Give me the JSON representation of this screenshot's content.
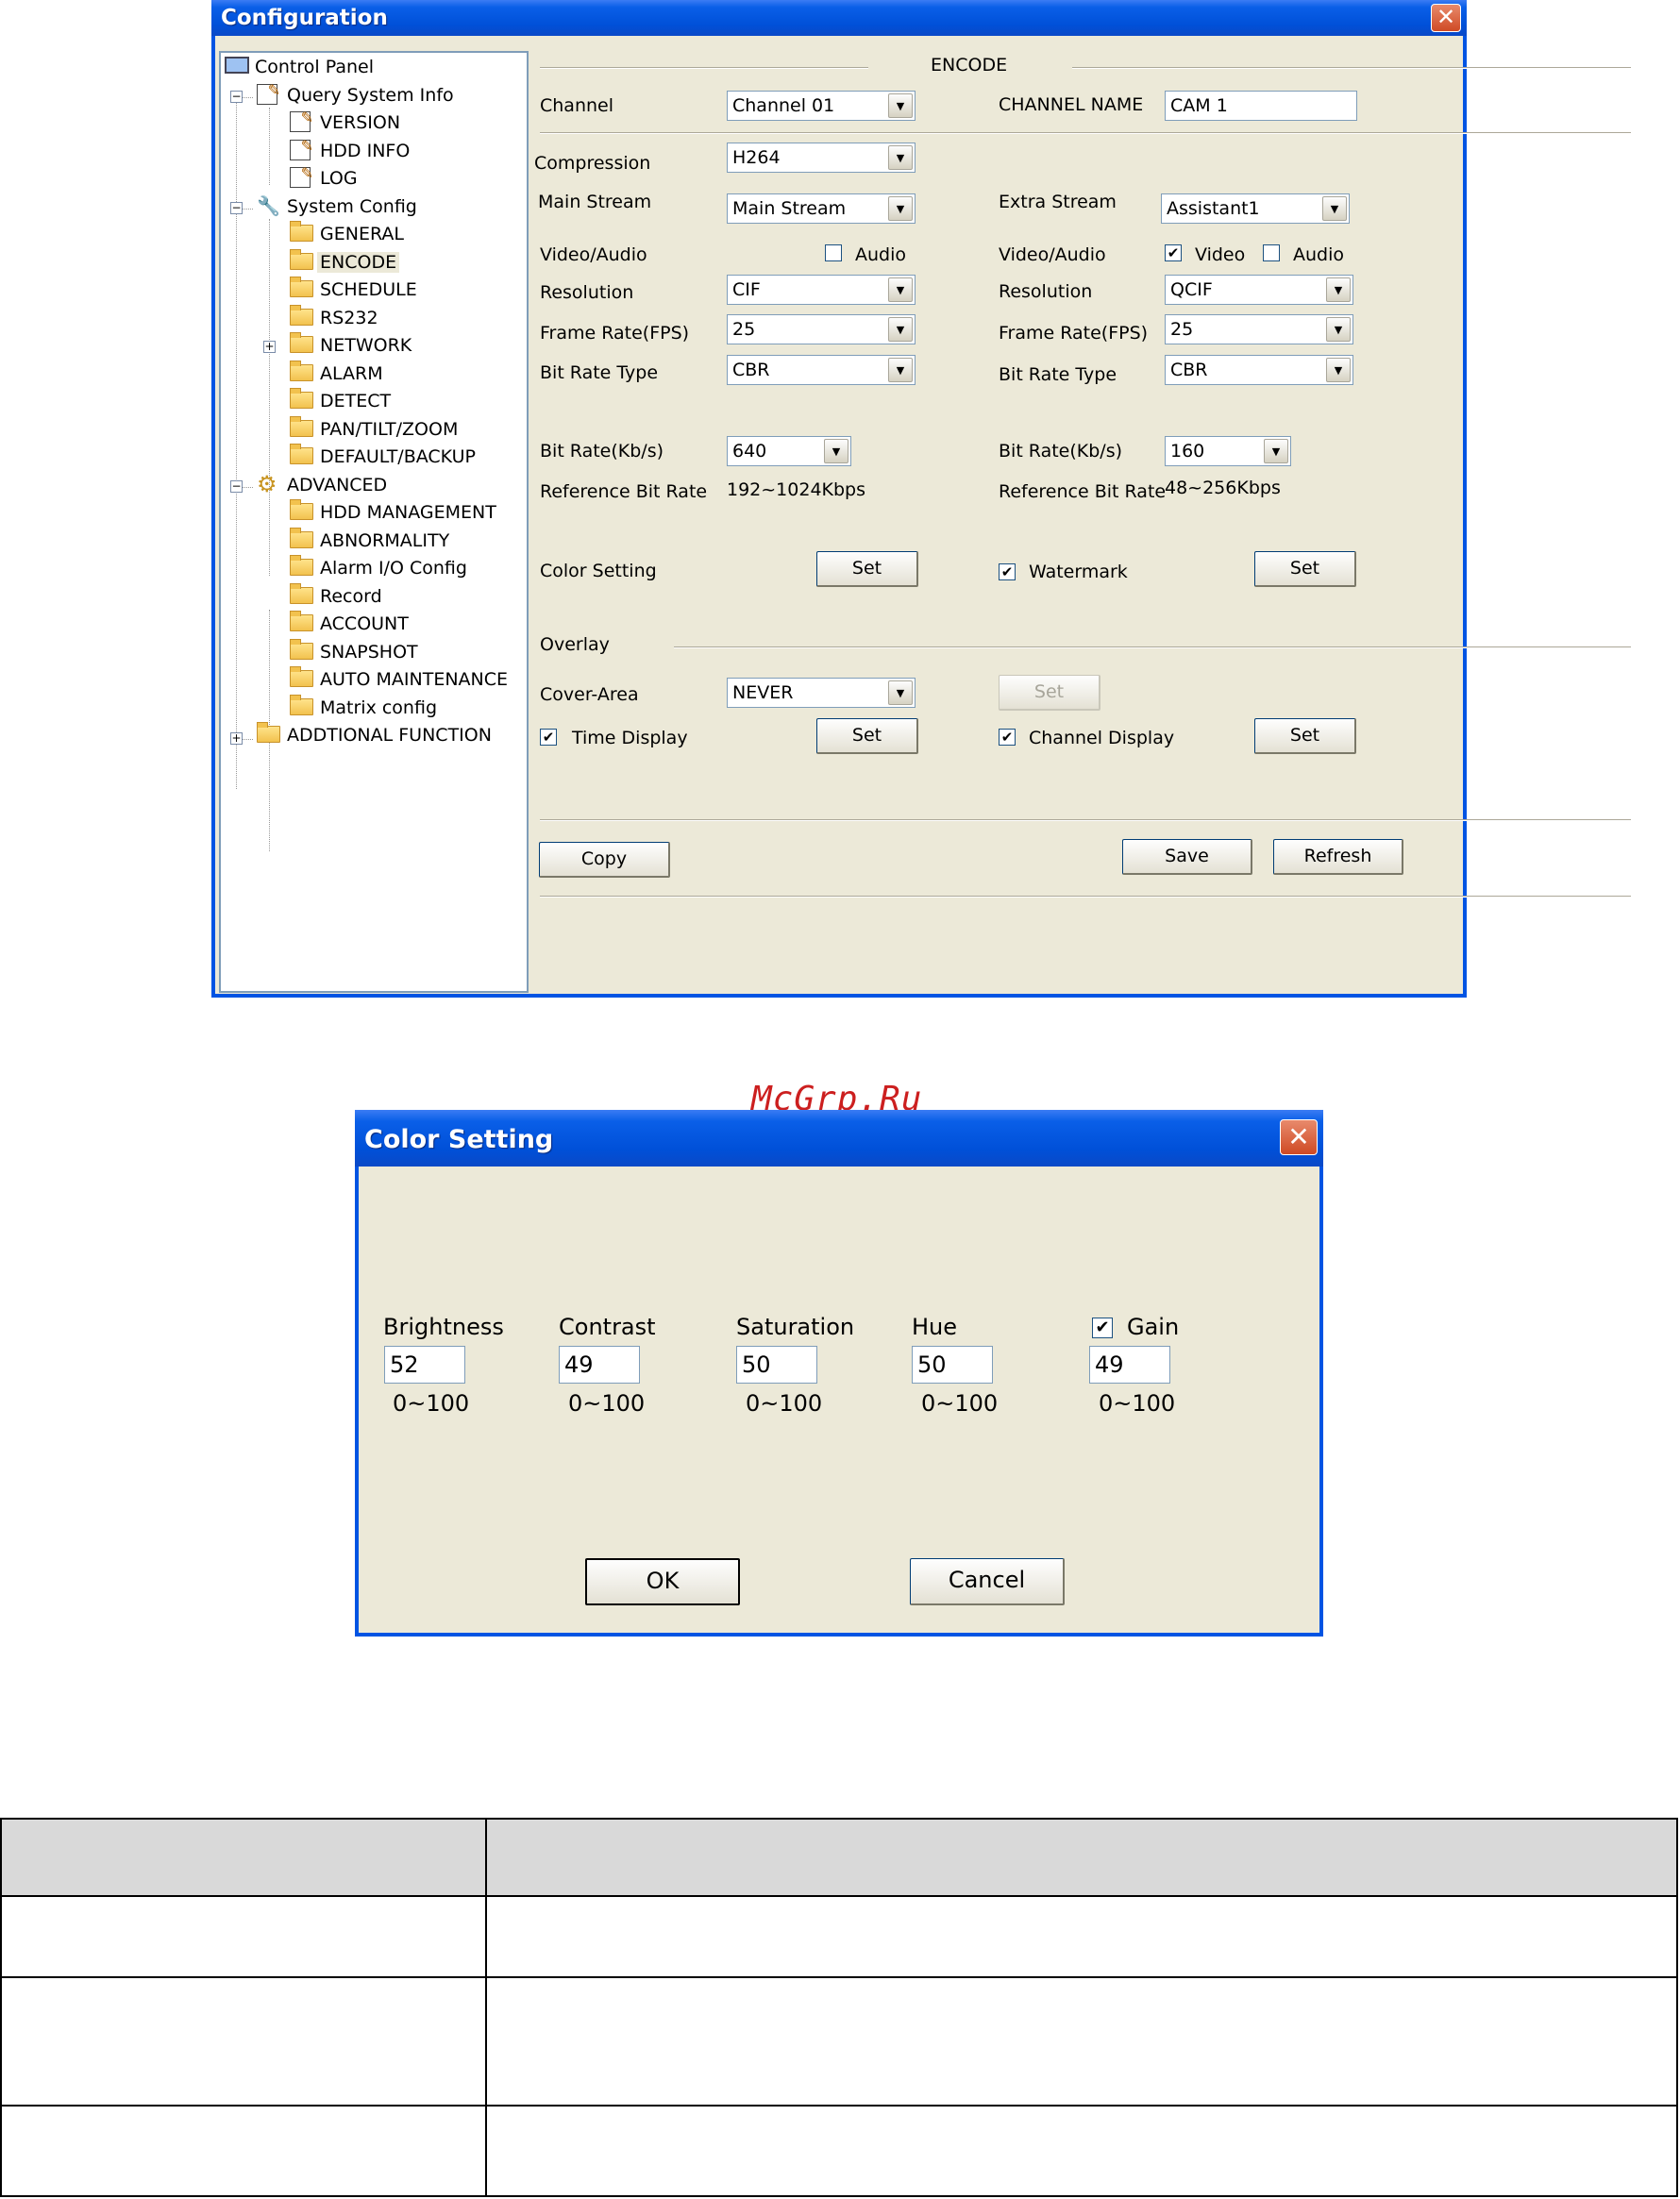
{
  "config_window": {
    "title": "Configuration",
    "tree": [
      {
        "label": "Control Panel"
      },
      {
        "label": "Query System Info"
      },
      {
        "label": "VERSION"
      },
      {
        "label": "HDD INFO"
      },
      {
        "label": "LOG"
      },
      {
        "label": "System Config"
      },
      {
        "label": "GENERAL"
      },
      {
        "label": "ENCODE"
      },
      {
        "label": "SCHEDULE"
      },
      {
        "label": "RS232"
      },
      {
        "label": "NETWORK"
      },
      {
        "label": "ALARM"
      },
      {
        "label": "DETECT"
      },
      {
        "label": "PAN/TILT/ZOOM"
      },
      {
        "label": "DEFAULT/BACKUP"
      },
      {
        "label": "ADVANCED"
      },
      {
        "label": "HDD MANAGEMENT"
      },
      {
        "label": "ABNORMALITY"
      },
      {
        "label": "Alarm I/O Config"
      },
      {
        "label": "Record"
      },
      {
        "label": "ACCOUNT"
      },
      {
        "label": "SNAPSHOT"
      },
      {
        "label": "AUTO MAINTENANCE"
      },
      {
        "label": "Matrix config"
      },
      {
        "label": "ADDTIONAL FUNCTION"
      }
    ],
    "encode": {
      "section_title": "ENCODE",
      "channel_label": "Channel",
      "channel_value": "Channel 01",
      "channel_name_label": "CHANNEL NAME",
      "channel_name_value": "CAM 1",
      "compression_label": "Compression",
      "compression_value": "H264",
      "main": {
        "stream_label": "Main Stream",
        "stream_value": "Main Stream",
        "video_audio_label": "Video/Audio",
        "audio_label": "Audio",
        "audio_checked": false,
        "resolution_label": "Resolution",
        "resolution_value": "CIF",
        "fps_label": "Frame Rate(FPS)",
        "fps_value": "25",
        "bitrate_type_label": "Bit Rate Type",
        "bitrate_type_value": "CBR",
        "bitrate_label": "Bit Rate(Kb/s)",
        "bitrate_value": "640",
        "ref_label": "Reference Bit Rate",
        "ref_value": "192~1024Kbps"
      },
      "extra": {
        "stream_label": "Extra Stream",
        "stream_value": "Assistant1",
        "video_audio_label": "Video/Audio",
        "video_label": "Video",
        "video_checked": true,
        "audio_label": "Audio",
        "audio_checked": false,
        "resolution_label": "Resolution",
        "resolution_value": "QCIF",
        "fps_label": "Frame Rate(FPS)",
        "fps_value": "25",
        "bitrate_type_label": "Bit Rate Type",
        "bitrate_type_value": "CBR",
        "bitrate_label": "Bit Rate(Kb/s)",
        "bitrate_value": "160",
        "ref_label": "Reference Bit Rate",
        "ref_value": "48~256Kbps"
      },
      "color_setting_label": "Color Setting",
      "watermark_label": "Watermark",
      "watermark_checked": true,
      "overlay_label": "Overlay",
      "cover_area_label": "Cover-Area",
      "cover_area_value": "NEVER",
      "time_display_label": "Time Display",
      "time_display_checked": true,
      "channel_display_label": "Channel Display",
      "channel_display_checked": true,
      "set_label": "Set",
      "copy_label": "Copy",
      "save_label": "Save",
      "refresh_label": "Refresh"
    }
  },
  "watermark_text": "McGrp.Ru",
  "color_dialog": {
    "title": "Color Setting",
    "fields": [
      {
        "label": "Brightness",
        "value": "52",
        "range": "0~100"
      },
      {
        "label": "Contrast",
        "value": "49",
        "range": "0~100"
      },
      {
        "label": "Saturation",
        "value": "50",
        "range": "0~100"
      },
      {
        "label": "Hue",
        "value": "50",
        "range": "0~100"
      },
      {
        "label": "Gain",
        "value": "49",
        "range": "0~100",
        "checked": true
      }
    ],
    "ok_label": "OK",
    "cancel_label": "Cancel"
  },
  "colors": {
    "title_blue": "#0054e3",
    "face": "#ece9d8",
    "close_red": "#d9542c",
    "watermark_red": "#cc1f1f"
  }
}
